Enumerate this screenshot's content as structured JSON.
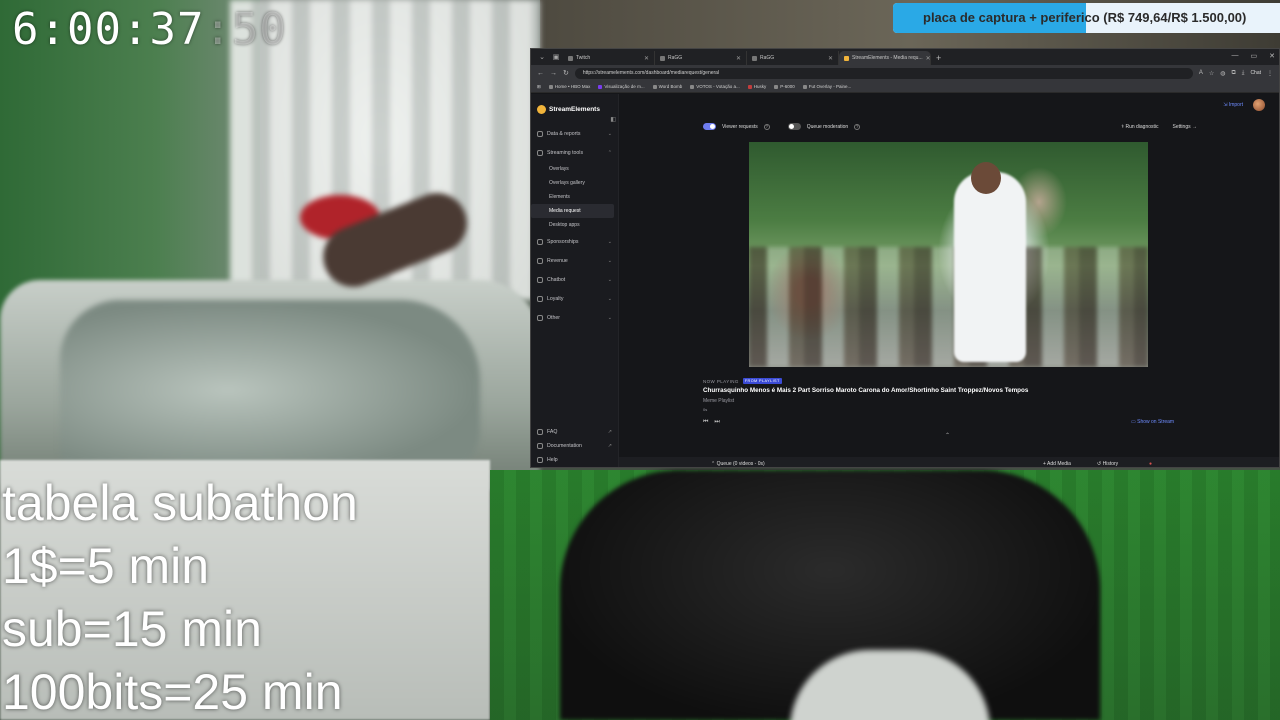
{
  "timer": {
    "main": "6:00:37",
    "ms": ":50"
  },
  "goal": {
    "text": "placa de captura + periferico (R$ 749,64/R$ 1.500,00)",
    "progress_percent": 49.98,
    "fill_color": "#2aa9e6"
  },
  "subathon": {
    "title": "tabela subathon",
    "lines": [
      "1$=5 min",
      "sub=15 min",
      "100bits=25 min"
    ]
  },
  "browser": {
    "tabs": [
      "Twitch",
      "RaGG",
      "RaGG",
      "StreamElements - Media requ..."
    ],
    "new_tab": "+",
    "url": "https://streamelements.com/dashboard/mediarequest/general",
    "chat_label": "Chat",
    "bookmarks": [
      "Home • HBO Max",
      "Visualização de m...",
      "Word Bomb",
      "VOTOS - Votação a...",
      "Husky",
      "P-6000",
      "Fut Overlay - Paine..."
    ]
  },
  "sidebar": {
    "brand": "StreamElements",
    "items": [
      {
        "label": "Data & reports"
      },
      {
        "label": "Streaming tools"
      },
      {
        "label": "Sponsorships"
      },
      {
        "label": "Revenue"
      },
      {
        "label": "Chatbot"
      },
      {
        "label": "Loyalty"
      },
      {
        "label": "Other"
      }
    ],
    "sub_items": [
      "Overlays",
      "Overlays gallery",
      "Elements",
      "Media request",
      "Desktop apps"
    ],
    "bottom": [
      "FAQ",
      "Documentation",
      "Help"
    ]
  },
  "main": {
    "import_label": "Import",
    "viewer_requests": "Viewer requests",
    "queue_moderation": "Queue moderation",
    "run_diagnostic": "Run diagnostic",
    "settings": "Settings →",
    "now_playing": "NOW PLAYING",
    "now_playing_tag": "FROM PLAYLIST",
    "song_title": "Churrasquinho Menos é Mais 2 Part Sorriso Maroto Carona do Amor/Shortinho Saint Troppez/Novos Tempos",
    "playlist": "Meme Playlist",
    "tiny": "0s",
    "show_on_stream": "Show on Stream",
    "queue": "Queue (0 videos - 0s)",
    "add_media": "Add Media",
    "history": "History"
  },
  "icons": {
    "prev": "⏮",
    "next": "⏭",
    "caret": "⌃"
  }
}
